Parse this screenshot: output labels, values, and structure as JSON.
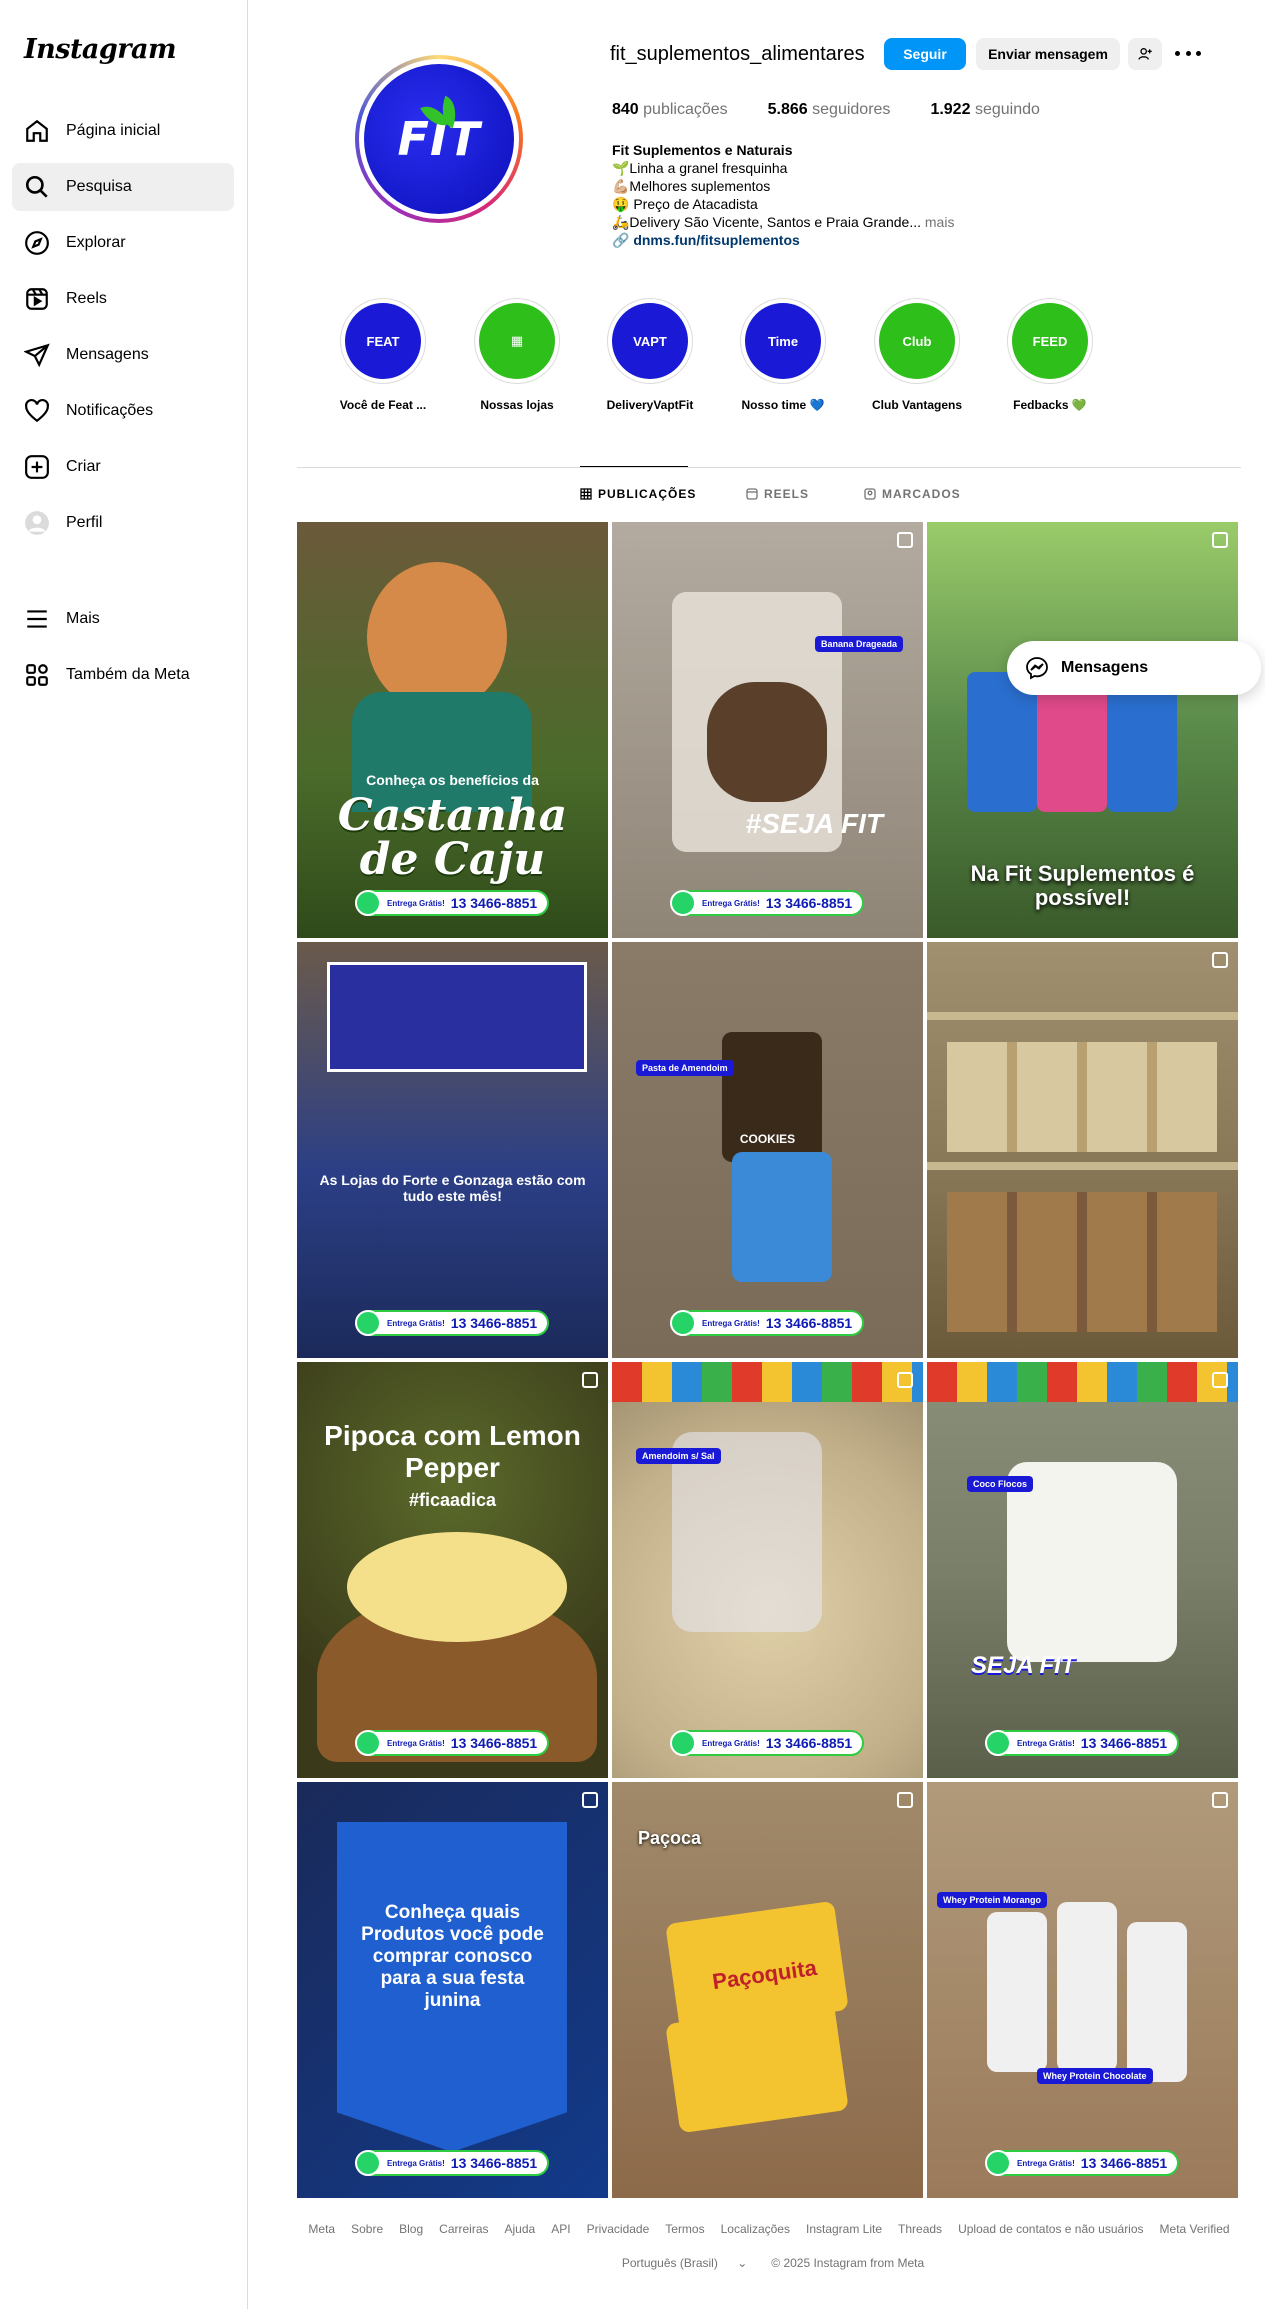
{
  "sidebar": {
    "logo": "Instagram",
    "items": [
      {
        "label": "Página inicial",
        "icon": "home-icon"
      },
      {
        "label": "Pesquisa",
        "icon": "search-icon"
      },
      {
        "label": "Explorar",
        "icon": "compass-icon"
      },
      {
        "label": "Reels",
        "icon": "reels-icon"
      },
      {
        "label": "Mensagens",
        "icon": "send-icon"
      },
      {
        "label": "Notificações",
        "icon": "heart-icon"
      },
      {
        "label": "Criar",
        "icon": "plus-square-icon"
      },
      {
        "label": "Perfil",
        "icon": "avatar-icon"
      }
    ],
    "bottom": [
      {
        "label": "Mais",
        "icon": "menu-icon"
      },
      {
        "label": "Também da Meta",
        "icon": "meta-apps-icon"
      }
    ]
  },
  "profile": {
    "username": "fit_suplementos_alimentares",
    "follow_label": "Seguir",
    "message_label": "Enviar mensagem",
    "stats": {
      "posts_count": "840",
      "posts_label": "publicações",
      "followers_count": "5.866",
      "followers_label": "seguidores",
      "following_count": "1.922",
      "following_label": "seguindo"
    },
    "bio": {
      "name": "Fit Suplementos e Naturais",
      "line1": "🌱Linha a granel fresquinha",
      "line2": "💪🏼Melhores suplementos",
      "line3": "🤑 Preço de Atacadista",
      "line4": "🛵Delivery São Vicente, Santos e Praia Grande...",
      "more": "mais",
      "link": "dnms.fun/fitsuplementos"
    },
    "avatar_text": "FIT"
  },
  "highlights": [
    {
      "label": "Você de Feat ...",
      "text": "FEAT",
      "color": "#1a1ad6"
    },
    {
      "label": "Nossas lojas",
      "text": "▦",
      "color": "#2fbf1a"
    },
    {
      "label": "DeliveryVaptFit",
      "text": "VAPT",
      "color": "#1a1ad6"
    },
    {
      "label": "Nosso time 💙",
      "text": "Time",
      "color": "#1a1ad6"
    },
    {
      "label": "Club Vantagens",
      "text": "Club",
      "color": "#2fbf1a"
    },
    {
      "label": "Fedbacks 💚",
      "text": "FEED",
      "color": "#2fbf1a"
    }
  ],
  "tabs": {
    "posts": "PUBLICAÇÕES",
    "reels": "REELS",
    "tagged": "MARCADOS"
  },
  "posts": [
    {
      "caption": "Castanha de Caju",
      "sub": "Conheça os benefícios da",
      "bg": "#4a6b2a"
    },
    {
      "caption": "#SEJA FIT",
      "sub": "Banana Drageada",
      "bg": "#8f8577"
    },
    {
      "caption": "Na Fit Suplementos é possível!",
      "sub": "",
      "bg": "#5a8a4a"
    },
    {
      "caption": "As Lojas do Forte e Gonzaga estão com tudo este mês!",
      "sub": "",
      "bg": "#2c3f86"
    },
    {
      "caption": "COOKIES",
      "sub": "Pasta de Amendoim",
      "bg": "#7a6a58"
    },
    {
      "caption": "",
      "sub": "",
      "bg": "#8b7a5a"
    },
    {
      "caption": "Pipoca com Lemon Pepper",
      "sub": "#ficaadica",
      "bg": "#8a5a2a"
    },
    {
      "caption": "Amendoim s/ Sal",
      "sub": "",
      "bg": "#c2b08a"
    },
    {
      "caption": "Coco Flocos",
      "sub": "SEJA FIT",
      "bg": "#7a7f6a"
    },
    {
      "caption": "Conheça quais Produtos você pode comprar conosco para a sua festa junina",
      "sub": "",
      "bg": "#1f5fcf"
    },
    {
      "caption": "Paçoca",
      "sub": "Paçoquita",
      "bg": "#8c6a4a"
    },
    {
      "caption": "Whey Protein Morango",
      "sub": "Whey Protein Chocolate",
      "bg": "#9a7a5a"
    }
  ],
  "whatsapp": {
    "number": "13 3466-8851",
    "small": "Entrega Grátis!"
  },
  "messages_button": "Mensagens",
  "footer": {
    "links": [
      "Meta",
      "Sobre",
      "Blog",
      "Carreiras",
      "Ajuda",
      "API",
      "Privacidade",
      "Termos",
      "Localizações",
      "Instagram Lite",
      "Threads",
      "Upload de contatos e não usuários",
      "Meta Verified"
    ],
    "language": "Português (Brasil)",
    "copyright": "© 2025 Instagram from Meta"
  }
}
